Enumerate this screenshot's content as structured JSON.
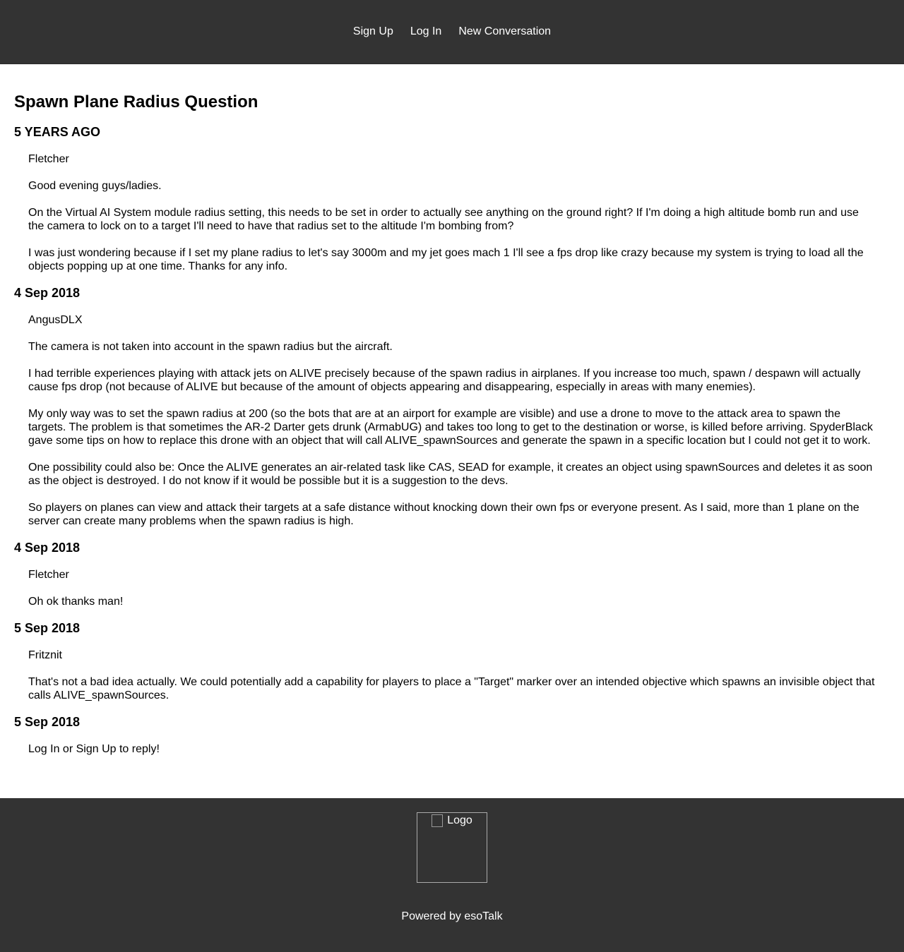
{
  "nav": {
    "signup": "Sign Up",
    "login": "Log In",
    "new_conversation": "New Conversation"
  },
  "conversation": {
    "title": "Spawn Plane Radius Question",
    "posts": [
      {
        "date": "5 YEARS AGO",
        "author": "Fletcher",
        "paragraphs": [
          "Good evening guys/ladies.",
          "On the Virtual AI System module radius setting, this needs to be set in order to actually see anything on the ground right? If I'm doing a high altitude bomb run and use the camera to lock on to a target I'll need to have that radius set to the altitude I'm bombing from?",
          "I was just wondering because if I set my plane radius to let's say 3000m and my jet goes mach 1 I'll see a fps drop like crazy because my system is trying to load all the objects popping up at one time. Thanks for any info."
        ]
      },
      {
        "date": "4 Sep 2018",
        "author": "AngusDLX",
        "paragraphs": [
          "The camera is not taken into account in the spawn radius but the aircraft.",
          "I had terrible experiences playing with attack jets on ALIVE precisely because of the spawn radius in airplanes. If you increase too much, spawn / despawn will actually cause fps drop (not because of ALIVE but because of the amount of objects appearing and disappearing, especially in areas with many enemies).",
          "My only way was to set the spawn radius at 200 (so the bots that are at an airport for example are visible) and use a drone to move to the attack area to spawn the targets. The problem is that sometimes the AR-2 Darter gets drunk (ArmabUG) and takes too long to get to the destination or worse, is killed before arriving. SpyderBlack gave some tips on how to replace this drone with an object that will call ALIVE_spawnSources and generate the spawn in a specific location but I could not get it to work.",
          "One possibility could also be: Once the ALIVE generates an air-related task like CAS, SEAD for example, it creates an object using spawnSources and deletes it as soon as the object is destroyed. I do not know if it would be possible but it is a suggestion to the devs.",
          "So players on planes can view and attack their targets at a safe distance without knocking down their own fps or everyone present. As I said, more than 1 plane on the server can create many problems when the spawn radius is high."
        ]
      },
      {
        "date": "4 Sep 2018",
        "author": "Fletcher",
        "paragraphs": [
          "Oh ok thanks man!"
        ]
      },
      {
        "date": "5 Sep 2018",
        "author": "Fritznit",
        "paragraphs": [
          "That's not a bad idea actually. We could potentially add a capability for players to place a \"Target\" marker over an intended objective which spawns an invisible object that calls ALIVE_spawnSources."
        ]
      }
    ],
    "reply": {
      "date": "5 Sep 2018",
      "text": "Log In or Sign Up to reply!"
    }
  },
  "footer": {
    "logo_alt": "Logo",
    "powered_by": "Powered by esoTalk"
  },
  "colors": {
    "bar_background": "#333333",
    "bar_text": "#ffffff"
  }
}
